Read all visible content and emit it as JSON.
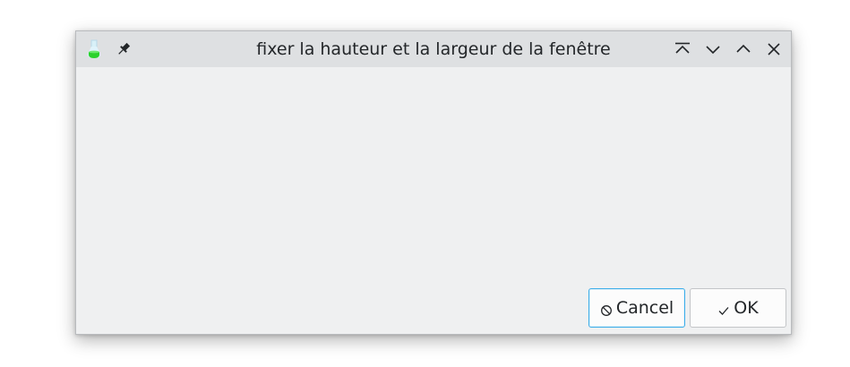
{
  "window": {
    "title": "fixer la hauteur et la largeur de la fenêtre",
    "app_icon": "flask-icon",
    "accent_color": "#3daee9",
    "titlebar_buttons": [
      "keep-above-icon",
      "minimize-icon",
      "maximize-icon",
      "close-icon"
    ]
  },
  "dialog": {
    "cancel_label": "Cancel",
    "ok_label": "OK",
    "cancel_icon": "cancel-icon",
    "ok_icon": "check-icon"
  }
}
